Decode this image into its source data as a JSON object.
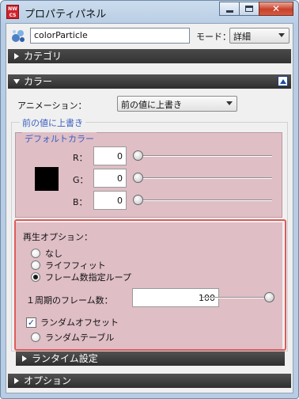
{
  "window": {
    "title": "プロパティパネル",
    "app_icon_text": "NW CS",
    "controls": {
      "minimize": "minimize",
      "maximize": "maximize",
      "close": "✕"
    }
  },
  "header": {
    "object_name": "colorParticle",
    "mode_label": "モード：",
    "mode_value": "詳細"
  },
  "sections": {
    "category": "カテゴリ",
    "color": "カラー",
    "runtime": "ランタイム設定",
    "options": "オプション"
  },
  "color": {
    "animation_label": "アニメーション：",
    "animation_value": "前の値に上書き",
    "overwrite_group_title": "前の値に上書き",
    "default_color_title": "デフォルトカラー",
    "channels": [
      {
        "label": "R：",
        "value": "0",
        "level": 0
      },
      {
        "label": "G：",
        "value": "0",
        "level": 0
      },
      {
        "label": "B：",
        "value": "0",
        "level": 0
      }
    ],
    "swatch_color": "#000000"
  },
  "playback": {
    "title": "再生オプション：",
    "options": [
      {
        "label": "なし",
        "selected": false
      },
      {
        "label": "ライフフィット",
        "selected": false
      },
      {
        "label": "フレーム数指定ループ",
        "selected": true
      }
    ],
    "frames_label": "１周期のフレーム数：",
    "frames_value": "100",
    "frames_level": 1.0,
    "random_offset_label": "ランダムオフセット",
    "random_offset_checked": true,
    "check_mark": "✓",
    "random_table_label": "ランダムテーブル",
    "random_table_selected": false
  },
  "colors": {
    "pink_panel": "#dfbec6",
    "highlight": "#e05b5b",
    "section_header": "#3a3a3a",
    "group_title": "#3a5fbf"
  }
}
